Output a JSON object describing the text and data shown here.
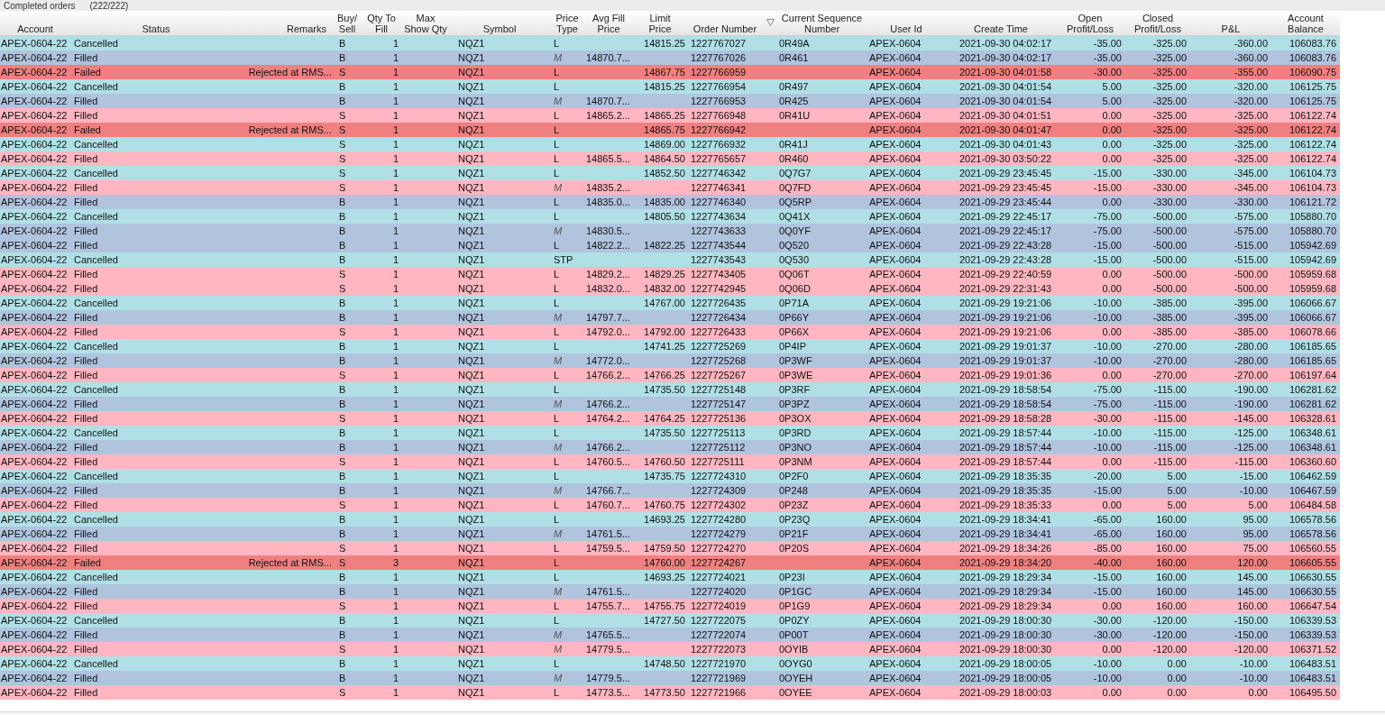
{
  "panel": {
    "title": "Completed orders",
    "count": "(222/222)"
  },
  "columns": [
    {
      "label": "Account"
    },
    {
      "label": "Status"
    },
    {
      "label": "Remarks"
    },
    {
      "label": "Buy/\nSell"
    },
    {
      "label": "Qty To\nFill"
    },
    {
      "label": "Max\nShow Qty"
    },
    {
      "label": "Symbol"
    },
    {
      "label": "Price\nType"
    },
    {
      "label": "Avg Fill\nPrice"
    },
    {
      "label": "Limit\nPrice"
    },
    {
      "label": "Order Number"
    },
    {
      "label": "Current Sequence\nNumber",
      "sorted": true
    },
    {
      "label": "User Id"
    },
    {
      "label": "Create Time"
    },
    {
      "label": "Open\nProfit/Loss"
    },
    {
      "label": "Closed\nProfit/Loss"
    },
    {
      "label": "P&L"
    },
    {
      "label": "Account\nBalance"
    }
  ],
  "rows": [
    {
      "color": "#b0e0e6",
      "account": "APEX-0604-22",
      "status": "Cancelled",
      "side": "B",
      "qty_to_fill": "1",
      "symbol": "NQZ1",
      "price_type": "L",
      "limit_price": "14815.25",
      "order_number": "1227767027",
      "sequence_number": "0R49A",
      "user_id": "APEX-0604",
      "create_time": "2021-09-30 04:02:17",
      "open_pl": "-35.00",
      "closed_pl": "-325.00",
      "pnl": "-360.00",
      "balance": "106083.76"
    },
    {
      "color": "#b0c4de",
      "account": "APEX-0604-22",
      "status": "Filled",
      "side": "B",
      "qty_to_fill": "1",
      "symbol": "NQZ1",
      "price_type": "M",
      "avg_fill_price": "14870.7...",
      "order_number": "1227767026",
      "sequence_number": "0R461",
      "user_id": "APEX-0604",
      "create_time": "2021-09-30 04:02:17",
      "open_pl": "-35.00",
      "closed_pl": "-325.00",
      "pnl": "-360.00",
      "balance": "106083.76"
    },
    {
      "color": "#f08080",
      "account": "APEX-0604-22",
      "status": "Failed",
      "remarks": "Rejected at RMS...",
      "side": "S",
      "qty_to_fill": "1",
      "symbol": "NQZ1",
      "price_type": "L",
      "limit_price": "14867.75",
      "order_number": "1227766959",
      "user_id": "APEX-0604",
      "create_time": "2021-09-30 04:01:58",
      "open_pl": "-30.00",
      "closed_pl": "-325.00",
      "pnl": "-355.00",
      "balance": "106090.75"
    },
    {
      "color": "#b0e0e6",
      "account": "APEX-0604-22",
      "status": "Cancelled",
      "side": "B",
      "qty_to_fill": "1",
      "symbol": "NQZ1",
      "price_type": "L",
      "limit_price": "14815.25",
      "order_number": "1227766954",
      "sequence_number": "0R497",
      "user_id": "APEX-0604",
      "create_time": "2021-09-30 04:01:54",
      "open_pl": "5.00",
      "closed_pl": "-325.00",
      "pnl": "-320.00",
      "balance": "106125.75"
    },
    {
      "color": "#b0c4de",
      "account": "APEX-0604-22",
      "status": "Filled",
      "side": "B",
      "qty_to_fill": "1",
      "symbol": "NQZ1",
      "price_type": "M",
      "avg_fill_price": "14870.7...",
      "order_number": "1227766953",
      "sequence_number": "0R425",
      "user_id": "APEX-0604",
      "create_time": "2021-09-30 04:01:54",
      "open_pl": "5.00",
      "closed_pl": "-325.00",
      "pnl": "-320.00",
      "balance": "106125.75"
    },
    {
      "color": "#ffb6c1",
      "account": "APEX-0604-22",
      "status": "Filled",
      "side": "S",
      "qty_to_fill": "1",
      "symbol": "NQZ1",
      "price_type": "L",
      "avg_fill_price": "14865.2...",
      "limit_price": "14865.25",
      "order_number": "1227766948",
      "sequence_number": "0R41U",
      "user_id": "APEX-0604",
      "create_time": "2021-09-30 04:01:51",
      "open_pl": "0.00",
      "closed_pl": "-325.00",
      "pnl": "-325.00",
      "balance": "106122.74"
    },
    {
      "color": "#f08080",
      "account": "APEX-0604-22",
      "status": "Failed",
      "remarks": "Rejected at RMS...",
      "side": "S",
      "qty_to_fill": "1",
      "symbol": "NQZ1",
      "price_type": "L",
      "limit_price": "14865.75",
      "order_number": "1227766942",
      "user_id": "APEX-0604",
      "create_time": "2021-09-30 04:01:47",
      "open_pl": "0.00",
      "closed_pl": "-325.00",
      "pnl": "-325.00",
      "balance": "106122.74"
    },
    {
      "color": "#b0e0e6",
      "account": "APEX-0604-22",
      "status": "Cancelled",
      "side": "S",
      "qty_to_fill": "1",
      "symbol": "NQZ1",
      "price_type": "L",
      "limit_price": "14869.00",
      "order_number": "1227766932",
      "sequence_number": "0R41J",
      "user_id": "APEX-0604",
      "create_time": "2021-09-30 04:01:43",
      "open_pl": "0.00",
      "closed_pl": "-325.00",
      "pnl": "-325.00",
      "balance": "106122.74"
    },
    {
      "color": "#ffb6c1",
      "account": "APEX-0604-22",
      "status": "Filled",
      "side": "S",
      "qty_to_fill": "1",
      "symbol": "NQZ1",
      "price_type": "L",
      "avg_fill_price": "14865.5...",
      "limit_price": "14864.50",
      "order_number": "1227765657",
      "sequence_number": "0R460",
      "user_id": "APEX-0604",
      "create_time": "2021-09-30 03:50:22",
      "open_pl": "0.00",
      "closed_pl": "-325.00",
      "pnl": "-325.00",
      "balance": "106122.74"
    },
    {
      "color": "#b0e0e6",
      "account": "APEX-0604-22",
      "status": "Cancelled",
      "side": "S",
      "qty_to_fill": "1",
      "symbol": "NQZ1",
      "price_type": "L",
      "limit_price": "14852.50",
      "order_number": "1227746342",
      "sequence_number": "0Q7G7",
      "user_id": "APEX-0604",
      "create_time": "2021-09-29 23:45:45",
      "open_pl": "-15.00",
      "closed_pl": "-330.00",
      "pnl": "-345.00",
      "balance": "106104.73"
    },
    {
      "color": "#ffb6c1",
      "account": "APEX-0604-22",
      "status": "Filled",
      "side": "S",
      "qty_to_fill": "1",
      "symbol": "NQZ1",
      "price_type": "M",
      "avg_fill_price": "14835.2...",
      "order_number": "1227746341",
      "sequence_number": "0Q7FD",
      "user_id": "APEX-0604",
      "create_time": "2021-09-29 23:45:45",
      "open_pl": "-15.00",
      "closed_pl": "-330.00",
      "pnl": "-345.00",
      "balance": "106104.73"
    },
    {
      "color": "#b0c4de",
      "account": "APEX-0604-22",
      "status": "Filled",
      "side": "B",
      "qty_to_fill": "1",
      "symbol": "NQZ1",
      "price_type": "L",
      "avg_fill_price": "14835.0...",
      "limit_price": "14835.00",
      "order_number": "1227746340",
      "sequence_number": "0Q5RP",
      "user_id": "APEX-0604",
      "create_time": "2021-09-29 23:45:44",
      "open_pl": "0.00",
      "closed_pl": "-330.00",
      "pnl": "-330.00",
      "balance": "106121.72"
    },
    {
      "color": "#b0e0e6",
      "account": "APEX-0604-22",
      "status": "Cancelled",
      "side": "B",
      "qty_to_fill": "1",
      "symbol": "NQZ1",
      "price_type": "L",
      "limit_price": "14805.50",
      "order_number": "1227743634",
      "sequence_number": "0Q41X",
      "user_id": "APEX-0604",
      "create_time": "2021-09-29 22:45:17",
      "open_pl": "-75.00",
      "closed_pl": "-500.00",
      "pnl": "-575.00",
      "balance": "105880.70"
    },
    {
      "color": "#b0c4de",
      "account": "APEX-0604-22",
      "status": "Filled",
      "side": "B",
      "qty_to_fill": "1",
      "symbol": "NQZ1",
      "price_type": "M",
      "avg_fill_price": "14830.5...",
      "order_number": "1227743633",
      "sequence_number": "0Q0YF",
      "user_id": "APEX-0604",
      "create_time": "2021-09-29 22:45:17",
      "open_pl": "-75.00",
      "closed_pl": "-500.00",
      "pnl": "-575.00",
      "balance": "105880.70"
    },
    {
      "color": "#b0c4de",
      "account": "APEX-0604-22",
      "status": "Filled",
      "side": "B",
      "qty_to_fill": "1",
      "symbol": "NQZ1",
      "price_type": "L",
      "avg_fill_price": "14822.2...",
      "limit_price": "14822.25",
      "order_number": "1227743544",
      "sequence_number": "0Q520",
      "user_id": "APEX-0604",
      "create_time": "2021-09-29 22:43:28",
      "open_pl": "-15.00",
      "closed_pl": "-500.00",
      "pnl": "-515.00",
      "balance": "105942.69"
    },
    {
      "color": "#b0e0e6",
      "account": "APEX-0604-22",
      "status": "Cancelled",
      "side": "B",
      "qty_to_fill": "1",
      "symbol": "NQZ1",
      "price_type": "STP",
      "order_number": "1227743543",
      "sequence_number": "0Q530",
      "user_id": "APEX-0604",
      "create_time": "2021-09-29 22:43:28",
      "open_pl": "-15.00",
      "closed_pl": "-500.00",
      "pnl": "-515.00",
      "balance": "105942.69"
    },
    {
      "color": "#ffb6c1",
      "account": "APEX-0604-22",
      "status": "Filled",
      "side": "S",
      "qty_to_fill": "1",
      "symbol": "NQZ1",
      "price_type": "L",
      "avg_fill_price": "14829.2...",
      "limit_price": "14829.25",
      "order_number": "1227743405",
      "sequence_number": "0Q06T",
      "user_id": "APEX-0604",
      "create_time": "2021-09-29 22:40:59",
      "open_pl": "0.00",
      "closed_pl": "-500.00",
      "pnl": "-500.00",
      "balance": "105959.68"
    },
    {
      "color": "#ffb6c1",
      "account": "APEX-0604-22",
      "status": "Filled",
      "side": "S",
      "qty_to_fill": "1",
      "symbol": "NQZ1",
      "price_type": "L",
      "avg_fill_price": "14832.0...",
      "limit_price": "14832.00",
      "order_number": "1227742945",
      "sequence_number": "0Q06D",
      "user_id": "APEX-0604",
      "create_time": "2021-09-29 22:31:43",
      "open_pl": "0.00",
      "closed_pl": "-500.00",
      "pnl": "-500.00",
      "balance": "105959.68"
    },
    {
      "color": "#b0e0e6",
      "account": "APEX-0604-22",
      "status": "Cancelled",
      "side": "B",
      "qty_to_fill": "1",
      "symbol": "NQZ1",
      "price_type": "L",
      "limit_price": "14767.00",
      "order_number": "1227726435",
      "sequence_number": "0P71A",
      "user_id": "APEX-0604",
      "create_time": "2021-09-29 19:21:06",
      "open_pl": "-10.00",
      "closed_pl": "-385.00",
      "pnl": "-395.00",
      "balance": "106066.67"
    },
    {
      "color": "#b0c4de",
      "account": "APEX-0604-22",
      "status": "Filled",
      "side": "B",
      "qty_to_fill": "1",
      "symbol": "NQZ1",
      "price_type": "M",
      "avg_fill_price": "14797.7...",
      "order_number": "1227726434",
      "sequence_number": "0P66Y",
      "user_id": "APEX-0604",
      "create_time": "2021-09-29 19:21:06",
      "open_pl": "-10.00",
      "closed_pl": "-385.00",
      "pnl": "-395.00",
      "balance": "106066.67"
    },
    {
      "color": "#ffb6c1",
      "account": "APEX-0604-22",
      "status": "Filled",
      "side": "S",
      "qty_to_fill": "1",
      "symbol": "NQZ1",
      "price_type": "L",
      "avg_fill_price": "14792.0...",
      "limit_price": "14792.00",
      "order_number": "1227726433",
      "sequence_number": "0P66X",
      "user_id": "APEX-0604",
      "create_time": "2021-09-29 19:21:06",
      "open_pl": "0.00",
      "closed_pl": "-385.00",
      "pnl": "-385.00",
      "balance": "106078.66"
    },
    {
      "color": "#b0e0e6",
      "account": "APEX-0604-22",
      "status": "Cancelled",
      "side": "B",
      "qty_to_fill": "1",
      "symbol": "NQZ1",
      "price_type": "L",
      "limit_price": "14741.25",
      "order_number": "1227725269",
      "sequence_number": "0P4IP",
      "user_id": "APEX-0604",
      "create_time": "2021-09-29 19:01:37",
      "open_pl": "-10.00",
      "closed_pl": "-270.00",
      "pnl": "-280.00",
      "balance": "106185.65"
    },
    {
      "color": "#b0c4de",
      "account": "APEX-0604-22",
      "status": "Filled",
      "side": "B",
      "qty_to_fill": "1",
      "symbol": "NQZ1",
      "price_type": "M",
      "avg_fill_price": "14772.0...",
      "order_number": "1227725268",
      "sequence_number": "0P3WF",
      "user_id": "APEX-0604",
      "create_time": "2021-09-29 19:01:37",
      "open_pl": "-10.00",
      "closed_pl": "-270.00",
      "pnl": "-280.00",
      "balance": "106185.65"
    },
    {
      "color": "#ffb6c1",
      "account": "APEX-0604-22",
      "status": "Filled",
      "side": "S",
      "qty_to_fill": "1",
      "symbol": "NQZ1",
      "price_type": "L",
      "avg_fill_price": "14766.2...",
      "limit_price": "14766.25",
      "order_number": "1227725267",
      "sequence_number": "0P3WE",
      "user_id": "APEX-0604",
      "create_time": "2021-09-29 19:01:36",
      "open_pl": "0.00",
      "closed_pl": "-270.00",
      "pnl": "-270.00",
      "balance": "106197.64"
    },
    {
      "color": "#b0e0e6",
      "account": "APEX-0604-22",
      "status": "Cancelled",
      "side": "B",
      "qty_to_fill": "1",
      "symbol": "NQZ1",
      "price_type": "L",
      "limit_price": "14735.50",
      "order_number": "1227725148",
      "sequence_number": "0P3RF",
      "user_id": "APEX-0604",
      "create_time": "2021-09-29 18:58:54",
      "open_pl": "-75.00",
      "closed_pl": "-115.00",
      "pnl": "-190.00",
      "balance": "106281.62"
    },
    {
      "color": "#b0c4de",
      "account": "APEX-0604-22",
      "status": "Filled",
      "side": "B",
      "qty_to_fill": "1",
      "symbol": "NQZ1",
      "price_type": "M",
      "avg_fill_price": "14766.2...",
      "order_number": "1227725147",
      "sequence_number": "0P3PZ",
      "user_id": "APEX-0604",
      "create_time": "2021-09-29 18:58:54",
      "open_pl": "-75.00",
      "closed_pl": "-115.00",
      "pnl": "-190.00",
      "balance": "106281.62"
    },
    {
      "color": "#ffb6c1",
      "account": "APEX-0604-22",
      "status": "Filled",
      "side": "S",
      "qty_to_fill": "1",
      "symbol": "NQZ1",
      "price_type": "L",
      "avg_fill_price": "14764.2...",
      "limit_price": "14764.25",
      "order_number": "1227725136",
      "sequence_number": "0P3OX",
      "user_id": "APEX-0604",
      "create_time": "2021-09-29 18:58:28",
      "open_pl": "-30.00",
      "closed_pl": "-115.00",
      "pnl": "-145.00",
      "balance": "106328.61"
    },
    {
      "color": "#b0e0e6",
      "account": "APEX-0604-22",
      "status": "Cancelled",
      "side": "B",
      "qty_to_fill": "1",
      "symbol": "NQZ1",
      "price_type": "L",
      "limit_price": "14735.50",
      "order_number": "1227725113",
      "sequence_number": "0P3RD",
      "user_id": "APEX-0604",
      "create_time": "2021-09-29 18:57:44",
      "open_pl": "-10.00",
      "closed_pl": "-115.00",
      "pnl": "-125.00",
      "balance": "106348.61"
    },
    {
      "color": "#b0c4de",
      "account": "APEX-0604-22",
      "status": "Filled",
      "side": "B",
      "qty_to_fill": "1",
      "symbol": "NQZ1",
      "price_type": "M",
      "avg_fill_price": "14766.2...",
      "order_number": "1227725112",
      "sequence_number": "0P3NO",
      "user_id": "APEX-0604",
      "create_time": "2021-09-29 18:57:44",
      "open_pl": "-10.00",
      "closed_pl": "-115.00",
      "pnl": "-125.00",
      "balance": "106348.61"
    },
    {
      "color": "#ffb6c1",
      "account": "APEX-0604-22",
      "status": "Filled",
      "side": "S",
      "qty_to_fill": "1",
      "symbol": "NQZ1",
      "price_type": "L",
      "avg_fill_price": "14760.5...",
      "limit_price": "14760.50",
      "order_number": "1227725111",
      "sequence_number": "0P3NM",
      "user_id": "APEX-0604",
      "create_time": "2021-09-29 18:57:44",
      "open_pl": "0.00",
      "closed_pl": "-115.00",
      "pnl": "-115.00",
      "balance": "106360.60"
    },
    {
      "color": "#b0e0e6",
      "account": "APEX-0604-22",
      "status": "Cancelled",
      "side": "B",
      "qty_to_fill": "1",
      "symbol": "NQZ1",
      "price_type": "L",
      "limit_price": "14735.75",
      "order_number": "1227724310",
      "sequence_number": "0P2F0",
      "user_id": "APEX-0604",
      "create_time": "2021-09-29 18:35:35",
      "open_pl": "-20.00",
      "closed_pl": "5.00",
      "pnl": "-15.00",
      "balance": "106462.59"
    },
    {
      "color": "#b0c4de",
      "account": "APEX-0604-22",
      "status": "Filled",
      "side": "B",
      "qty_to_fill": "1",
      "symbol": "NQZ1",
      "price_type": "M",
      "avg_fill_price": "14766.7...",
      "order_number": "1227724309",
      "sequence_number": "0P248",
      "user_id": "APEX-0604",
      "create_time": "2021-09-29 18:35:35",
      "open_pl": "-15.00",
      "closed_pl": "5.00",
      "pnl": "-10.00",
      "balance": "106467.59"
    },
    {
      "color": "#ffb6c1",
      "account": "APEX-0604-22",
      "status": "Filled",
      "side": "S",
      "qty_to_fill": "1",
      "symbol": "NQZ1",
      "price_type": "L",
      "avg_fill_price": "14760.7...",
      "limit_price": "14760.75",
      "order_number": "1227724302",
      "sequence_number": "0P23Z",
      "user_id": "APEX-0604",
      "create_time": "2021-09-29 18:35:33",
      "open_pl": "0.00",
      "closed_pl": "5.00",
      "pnl": "5.00",
      "balance": "106484.58"
    },
    {
      "color": "#b0e0e6",
      "account": "APEX-0604-22",
      "status": "Cancelled",
      "side": "B",
      "qty_to_fill": "1",
      "symbol": "NQZ1",
      "price_type": "L",
      "limit_price": "14693.25",
      "order_number": "1227724280",
      "sequence_number": "0P23Q",
      "user_id": "APEX-0604",
      "create_time": "2021-09-29 18:34:41",
      "open_pl": "-65.00",
      "closed_pl": "160.00",
      "pnl": "95.00",
      "balance": "106578.56"
    },
    {
      "color": "#b0c4de",
      "account": "APEX-0604-22",
      "status": "Filled",
      "side": "B",
      "qty_to_fill": "1",
      "symbol": "NQZ1",
      "price_type": "M",
      "avg_fill_price": "14761.5...",
      "order_number": "1227724279",
      "sequence_number": "0P21F",
      "user_id": "APEX-0604",
      "create_time": "2021-09-29 18:34:41",
      "open_pl": "-65.00",
      "closed_pl": "160.00",
      "pnl": "95.00",
      "balance": "106578.56"
    },
    {
      "color": "#ffb6c1",
      "account": "APEX-0604-22",
      "status": "Filled",
      "side": "S",
      "qty_to_fill": "1",
      "symbol": "NQZ1",
      "price_type": "L",
      "avg_fill_price": "14759.5...",
      "limit_price": "14759.50",
      "order_number": "1227724270",
      "sequence_number": "0P20S",
      "user_id": "APEX-0604",
      "create_time": "2021-09-29 18:34:26",
      "open_pl": "-85.00",
      "closed_pl": "160.00",
      "pnl": "75.00",
      "balance": "106560.55"
    },
    {
      "color": "#f08080",
      "account": "APEX-0604-22",
      "status": "Failed",
      "remarks": "Rejected at RMS...",
      "side": "S",
      "qty_to_fill": "3",
      "symbol": "NQZ1",
      "price_type": "L",
      "limit_price": "14760.00",
      "order_number": "1227724267",
      "user_id": "APEX-0604",
      "create_time": "2021-09-29 18:34:20",
      "open_pl": "-40.00",
      "closed_pl": "160.00",
      "pnl": "120.00",
      "balance": "106605.55"
    },
    {
      "color": "#b0e0e6",
      "account": "APEX-0604-22",
      "status": "Cancelled",
      "side": "B",
      "qty_to_fill": "1",
      "symbol": "NQZ1",
      "price_type": "L",
      "limit_price": "14693.25",
      "order_number": "1227724021",
      "sequence_number": "0P23I",
      "user_id": "APEX-0604",
      "create_time": "2021-09-29 18:29:34",
      "open_pl": "-15.00",
      "closed_pl": "160.00",
      "pnl": "145.00",
      "balance": "106630.55"
    },
    {
      "color": "#b0c4de",
      "account": "APEX-0604-22",
      "status": "Filled",
      "side": "B",
      "qty_to_fill": "1",
      "symbol": "NQZ1",
      "price_type": "M",
      "avg_fill_price": "14761.5...",
      "order_number": "1227724020",
      "sequence_number": "0P1GC",
      "user_id": "APEX-0604",
      "create_time": "2021-09-29 18:29:34",
      "open_pl": "-15.00",
      "closed_pl": "160.00",
      "pnl": "145.00",
      "balance": "106630.55"
    },
    {
      "color": "#ffb6c1",
      "account": "APEX-0604-22",
      "status": "Filled",
      "side": "S",
      "qty_to_fill": "1",
      "symbol": "NQZ1",
      "price_type": "L",
      "avg_fill_price": "14755.7...",
      "limit_price": "14755.75",
      "order_number": "1227724019",
      "sequence_number": "0P1G9",
      "user_id": "APEX-0604",
      "create_time": "2021-09-29 18:29:34",
      "open_pl": "0.00",
      "closed_pl": "160.00",
      "pnl": "160.00",
      "balance": "106647.54"
    },
    {
      "color": "#b0e0e6",
      "account": "APEX-0604-22",
      "status": "Cancelled",
      "side": "B",
      "qty_to_fill": "1",
      "symbol": "NQZ1",
      "price_type": "L",
      "limit_price": "14727.50",
      "order_number": "1227722075",
      "sequence_number": "0P0ZY",
      "user_id": "APEX-0604",
      "create_time": "2021-09-29 18:00:30",
      "open_pl": "-30.00",
      "closed_pl": "-120.00",
      "pnl": "-150.00",
      "balance": "106339.53"
    },
    {
      "color": "#b0c4de",
      "account": "APEX-0604-22",
      "status": "Filled",
      "side": "B",
      "qty_to_fill": "1",
      "symbol": "NQZ1",
      "price_type": "M",
      "avg_fill_price": "14765.5...",
      "order_number": "1227722074",
      "sequence_number": "0P00T",
      "user_id": "APEX-0604",
      "create_time": "2021-09-29 18:00:30",
      "open_pl": "-30.00",
      "closed_pl": "-120.00",
      "pnl": "-150.00",
      "balance": "106339.53"
    },
    {
      "color": "#ffb6c1",
      "account": "APEX-0604-22",
      "status": "Filled",
      "side": "S",
      "qty_to_fill": "1",
      "symbol": "NQZ1",
      "price_type": "M",
      "avg_fill_price": "14779.5...",
      "order_number": "1227722073",
      "sequence_number": "0OYIB",
      "user_id": "APEX-0604",
      "create_time": "2021-09-29 18:00:30",
      "open_pl": "0.00",
      "closed_pl": "-120.00",
      "pnl": "-120.00",
      "balance": "106371.52"
    },
    {
      "color": "#b0e0e6",
      "account": "APEX-0604-22",
      "status": "Cancelled",
      "side": "B",
      "qty_to_fill": "1",
      "symbol": "NQZ1",
      "price_type": "L",
      "limit_price": "14748.50",
      "order_number": "1227721970",
      "sequence_number": "0OYG0",
      "user_id": "APEX-0604",
      "create_time": "2021-09-29 18:00:05",
      "open_pl": "-10.00",
      "closed_pl": "0.00",
      "pnl": "-10.00",
      "balance": "106483.51"
    },
    {
      "color": "#b0c4de",
      "account": "APEX-0604-22",
      "status": "Filled",
      "side": "B",
      "qty_to_fill": "1",
      "symbol": "NQZ1",
      "price_type": "M",
      "avg_fill_price": "14779.5...",
      "order_number": "1227721969",
      "sequence_number": "0OYEH",
      "user_id": "APEX-0604",
      "create_time": "2021-09-29 18:00:05",
      "open_pl": "-10.00",
      "closed_pl": "0.00",
      "pnl": "-10.00",
      "balance": "106483.51"
    },
    {
      "color": "#ffb6c1",
      "account": "APEX-0604-22",
      "status": "Filled",
      "side": "S",
      "qty_to_fill": "1",
      "symbol": "NQZ1",
      "price_type": "L",
      "avg_fill_price": "14773.5...",
      "limit_price": "14773.50",
      "order_number": "1227721966",
      "sequence_number": "0OYEE",
      "user_id": "APEX-0604",
      "create_time": "2021-09-29 18:00:03",
      "open_pl": "0.00",
      "closed_pl": "0.00",
      "pnl": "0.00",
      "balance": "106495.50"
    }
  ]
}
